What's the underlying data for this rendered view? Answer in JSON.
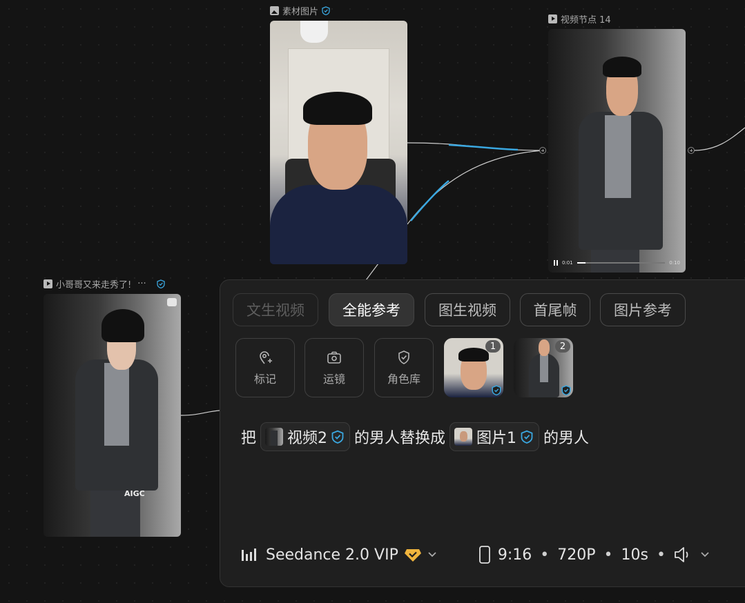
{
  "nodes": {
    "source_image": {
      "title": "素材图片"
    },
    "video_node": {
      "title": "视频节点 14",
      "time_current": "0:01",
      "time_total": "0:10"
    },
    "left_video": {
      "title": "小哥哥又来走秀了!",
      "more": "···",
      "watermark": "AIGC"
    }
  },
  "panel": {
    "tabs": [
      {
        "label": "文生视频",
        "state": "disabled"
      },
      {
        "label": "全能参考",
        "state": "active"
      },
      {
        "label": "图生视频",
        "state": "normal"
      },
      {
        "label": "首尾帧",
        "state": "normal"
      },
      {
        "label": "图片参考",
        "state": "normal"
      }
    ],
    "tools": [
      {
        "label": "标记",
        "icon": "pin-plus-icon"
      },
      {
        "label": "运镜",
        "icon": "camera-icon"
      },
      {
        "label": "角色库",
        "icon": "shield-check-icon"
      }
    ],
    "refs": [
      {
        "num": "1"
      },
      {
        "num": "2"
      }
    ],
    "prompt": {
      "p1": "把",
      "chip1": "视频2",
      "p2": "的男人替换成",
      "chip2": "图片1",
      "p3": "的男人"
    },
    "footer": {
      "model": "Seedance 2.0 VIP",
      "ratio": "9:16",
      "resolution": "720P",
      "duration": "10s",
      "sep": "•"
    }
  },
  "colors": {
    "accent": "#3aa7e0",
    "vip": "#f1b53d",
    "bg": "#141414",
    "panel": "#1f1f1f"
  }
}
